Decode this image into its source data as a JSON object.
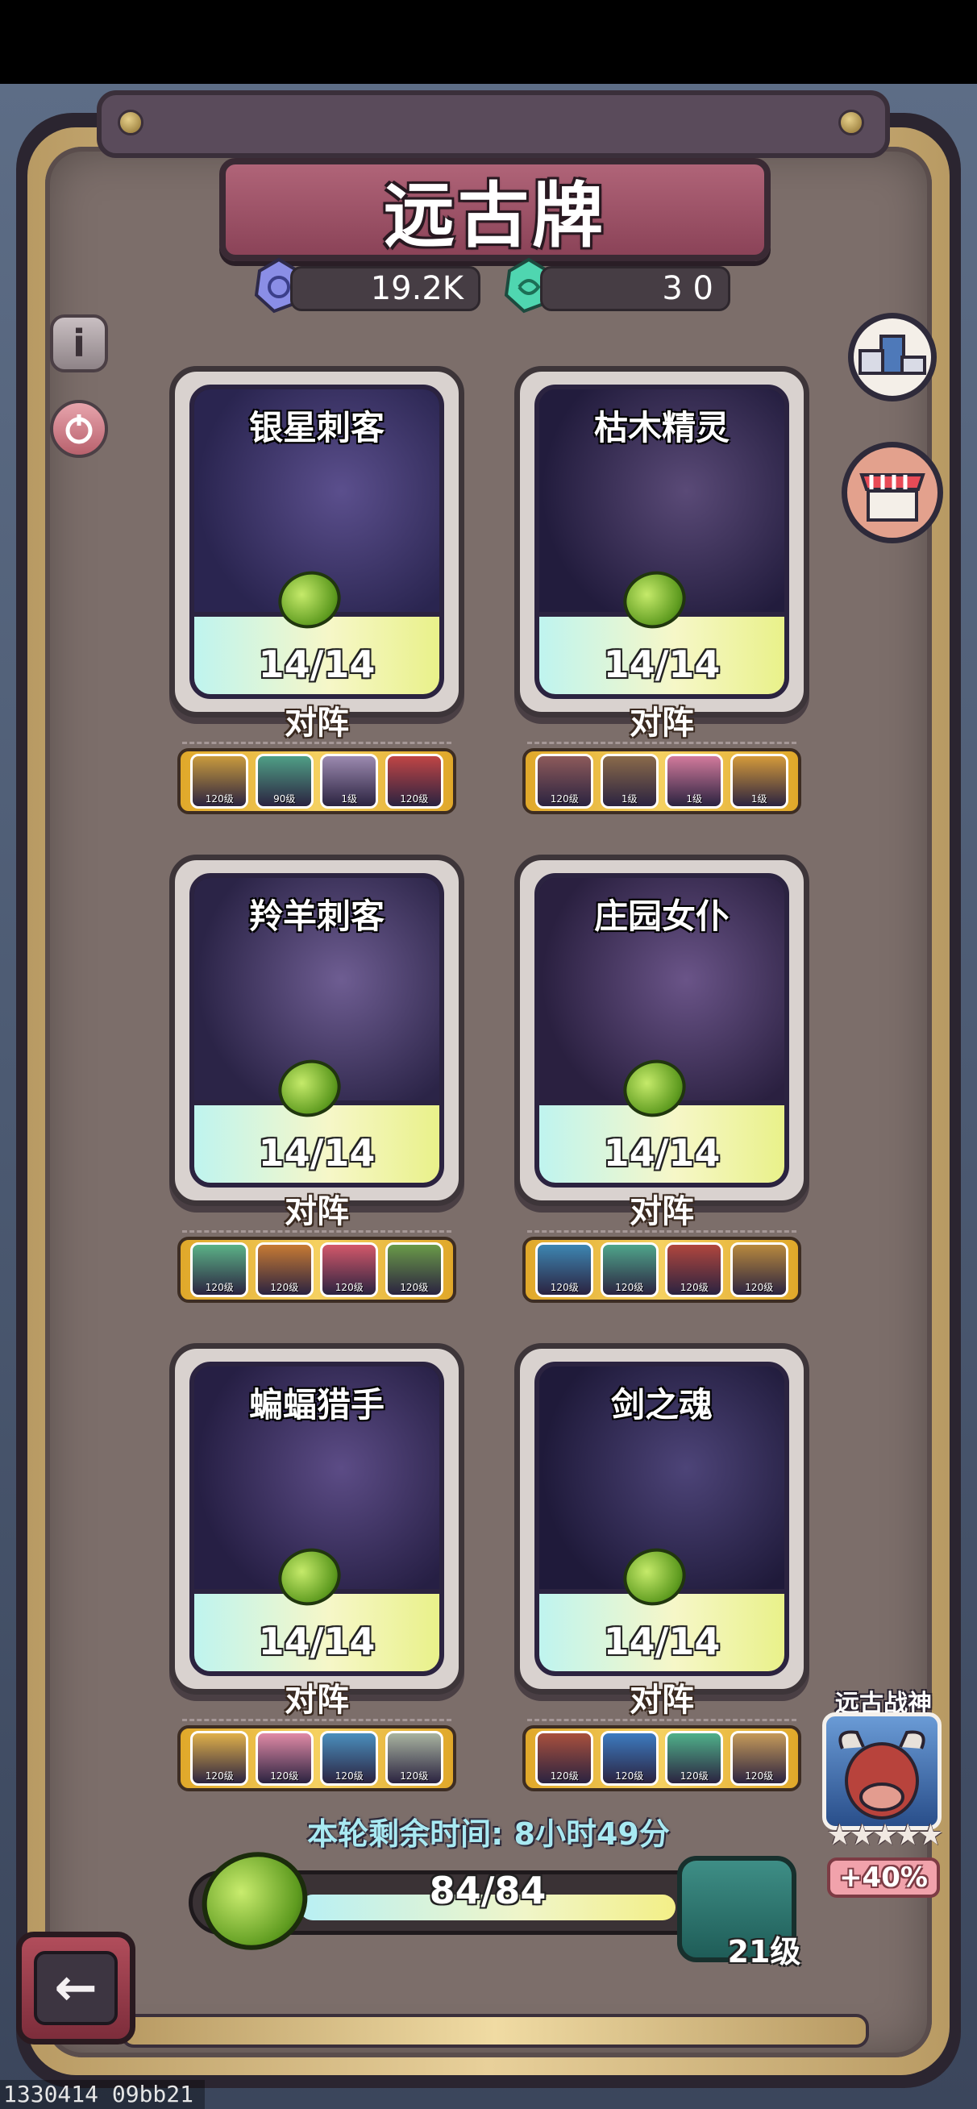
{
  "title": "远古牌",
  "resources": [
    {
      "name": "blue-gem",
      "value": "19.2K",
      "color": "#8a8ee6"
    },
    {
      "name": "green-gem",
      "value": "3 0",
      "color": "#4fd6b0"
    }
  ],
  "cards": [
    {
      "name": "银星刺客",
      "count": "14/14",
      "vs": "对阵",
      "art": [
        "#2a2550",
        "#5b4f8d"
      ],
      "team": [
        {
          "lvl": "120级",
          "c": "#c99b3d"
        },
        {
          "lvl": "90级",
          "c": "#4f9f86"
        },
        {
          "lvl": "1级",
          "c": "#9c8ab0"
        },
        {
          "lvl": "120级",
          "c": "#c04545"
        }
      ]
    },
    {
      "name": "枯木精灵",
      "count": "14/14",
      "vs": "对阵",
      "art": [
        "#221c3d",
        "#5a4a77"
      ],
      "team": [
        {
          "lvl": "120级",
          "c": "#8d5a5a"
        },
        {
          "lvl": "1级",
          "c": "#8a6a4a"
        },
        {
          "lvl": "1级",
          "c": "#d27a9c"
        },
        {
          "lvl": "1级",
          "c": "#d49a3a"
        }
      ]
    },
    {
      "name": "羚羊刺客",
      "count": "14/14",
      "vs": "对阵",
      "art": [
        "#2b2447",
        "#6e5d92"
      ],
      "team": [
        {
          "lvl": "120级",
          "c": "#5bb287"
        },
        {
          "lvl": "120级",
          "c": "#c77a33"
        },
        {
          "lvl": "120级",
          "c": "#d3586a"
        },
        {
          "lvl": "120级",
          "c": "#6a9a48"
        }
      ]
    },
    {
      "name": "庄园女仆",
      "count": "14/14",
      "vs": "对阵",
      "art": [
        "#2a2040",
        "#6a5488"
      ],
      "team": [
        {
          "lvl": "120级",
          "c": "#3d86b2"
        },
        {
          "lvl": "120级",
          "c": "#4fa58b"
        },
        {
          "lvl": "120级",
          "c": "#b0463d"
        },
        {
          "lvl": "120级",
          "c": "#b8893d"
        }
      ]
    },
    {
      "name": "蝙蝠猎手",
      "count": "14/14",
      "vs": "对阵",
      "art": [
        "#261f44",
        "#5c4c86"
      ],
      "team": [
        {
          "lvl": "120级",
          "c": "#e0b04a"
        },
        {
          "lvl": "120级",
          "c": "#e08aa6"
        },
        {
          "lvl": "120级",
          "c": "#4a8fbd"
        },
        {
          "lvl": "120级",
          "c": "#a8b3a0"
        }
      ]
    },
    {
      "name": "剑之魂",
      "count": "14/14",
      "vs": "对阵",
      "art": [
        "#1f1a3a",
        "#4d4478"
      ],
      "team": [
        {
          "lvl": "120级",
          "c": "#a8503d"
        },
        {
          "lvl": "120级",
          "c": "#3c7bc0"
        },
        {
          "lvl": "120级",
          "c": "#4fb08a"
        },
        {
          "lvl": "120级",
          "c": "#c59a5a"
        }
      ]
    }
  ],
  "timer": "本轮剩余时间: 8小时49分",
  "progress": {
    "text": "84/84",
    "value": 84,
    "max": 84
  },
  "level": "21级",
  "war_god": {
    "title": "远古战神",
    "stars": "★★★★★",
    "bonus": "+40%"
  },
  "footer_id": "1330414 09bb21",
  "side_buttons": {
    "info_icon": "i"
  },
  "back_icon": "←"
}
